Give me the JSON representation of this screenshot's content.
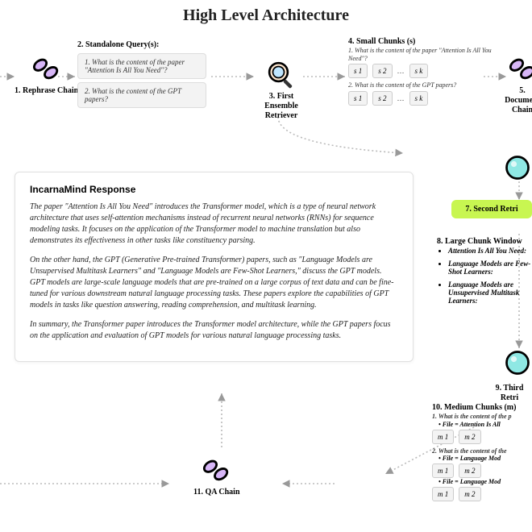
{
  "title": "High Level Architecture",
  "nodes": {
    "rephrase": {
      "num": "1.",
      "label": "Rephrase Chain"
    },
    "standalone": {
      "num": "2.",
      "label": "Standalone Query(s):",
      "q1": "1. What is the content of the paper \"Attention Is All You Need\"?",
      "q2": "2. What is the content of the GPT papers?"
    },
    "retriever1": {
      "num": "3.",
      "label": "First Ensemble Retriever"
    },
    "smallchunks": {
      "num": "4.",
      "label": "Small Chunks (s)",
      "q1": "1. What is the content of the paper \"Attention Is All You Need\"?",
      "q2": "2. What is the content of the GPT papers?",
      "c1": "s 1",
      "c2": "s 2",
      "ck": "s k"
    },
    "document": {
      "num": "5.",
      "label": "Document Chain"
    },
    "second": {
      "num": "7.",
      "label": "Second Retri"
    },
    "largewin": {
      "num": "8.",
      "label": "Large Chunk Window",
      "b1": "Attention Is All You Need:",
      "b2": "Language Models are Few-Shot Learners:",
      "b3": "Language Models are Unsupervised Multitask Learners:"
    },
    "third": {
      "num": "9.",
      "label": "Third Retri"
    },
    "medium": {
      "num": "10.",
      "label": "Medium Chunks (m)",
      "q1": "1. What is the content of the p",
      "f1": "• File = Attention Is All",
      "q2": "2. What is the content of the",
      "f2": "• File = Language Mod",
      "f3": "• File = Language Mod",
      "c1": "m 1",
      "c2": "m 2"
    },
    "qa": {
      "num": "11.",
      "label": "QA Chain"
    }
  },
  "response": {
    "heading": "IncarnaMind Response",
    "p1": "The paper \"Attention Is All You Need\" introduces the Transformer model, which is a type of neural network architecture that uses self-attention mechanisms instead of recurrent neural networks (RNNs) for sequence modeling tasks. It focuses on the application of the Transformer model to machine translation but also demonstrates its effectiveness in other tasks like constituency parsing.",
    "p2": "On the other hand, the GPT (Generative Pre-trained Transformer) papers, such as \"Language Models are Unsupervised Multitask Learners\" and \"Language Models are Few-Shot Learners,\" discuss the GPT models. GPT models are large-scale language models that are pre-trained on a large corpus of text data and can be fine-tuned for various downstream natural language processing tasks. These papers explore the capabilities of GPT models in tasks like question answering, reading comprehension, and multitask learning.",
    "p3": "In summary, the Transformer paper introduces the Transformer model architecture, while the GPT papers focus on the application and evaluation of GPT models for various natural language processing tasks."
  }
}
